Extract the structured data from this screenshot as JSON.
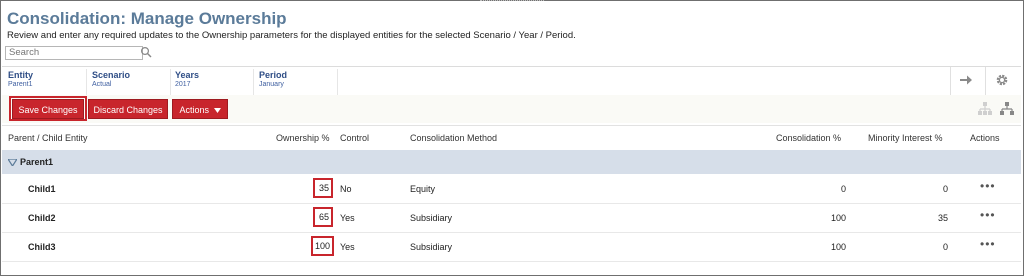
{
  "page": {
    "title": "Consolidation: Manage Ownership",
    "description": "Review and enter any required updates to the Ownership parameters for the displayed entities for the selected Scenario / Year / Period.",
    "search_placeholder": "Search"
  },
  "pov": [
    {
      "label": "Entity",
      "value": "Parent1"
    },
    {
      "label": "Scenario",
      "value": "Actual"
    },
    {
      "label": "Years",
      "value": "2017"
    },
    {
      "label": "Period",
      "value": "January"
    }
  ],
  "toolbar": {
    "save_label": "Save Changes",
    "discard_label": "Discard Changes",
    "actions_label": "Actions"
  },
  "columns": {
    "entity": "Parent / Child Entity",
    "ownership": "Ownership %",
    "control": "Control",
    "method": "Consolidation Method",
    "consolidation": "Consolidation %",
    "minority": "Minority Interest %",
    "actions": "Actions"
  },
  "parent": {
    "name": "Parent1"
  },
  "rows": [
    {
      "entity": "Child1",
      "ownership": "35",
      "control": "No",
      "method": "Equity",
      "consolidation": "0",
      "minority": "0",
      "actions": "•••"
    },
    {
      "entity": "Child2",
      "ownership": "65",
      "control": "Yes",
      "method": "Subsidiary",
      "consolidation": "100",
      "minority": "35",
      "actions": "•••"
    },
    {
      "entity": "Child3",
      "ownership": "100",
      "control": "Yes",
      "method": "Subsidiary",
      "consolidation": "100",
      "minority": "0",
      "actions": "•••"
    }
  ],
  "colors": {
    "accent_red": "#c8252c",
    "title_blue": "#5b7b99",
    "pov_blue": "#2f4e86",
    "parent_row_bg": "#d6dee9"
  },
  "icons": [
    "search-icon",
    "arrow-right-icon",
    "gear-icon",
    "hierarchy-expand-icon",
    "hierarchy-collapse-icon",
    "triangle-down-icon",
    "caret-down-icon",
    "ellipsis-icon"
  ]
}
